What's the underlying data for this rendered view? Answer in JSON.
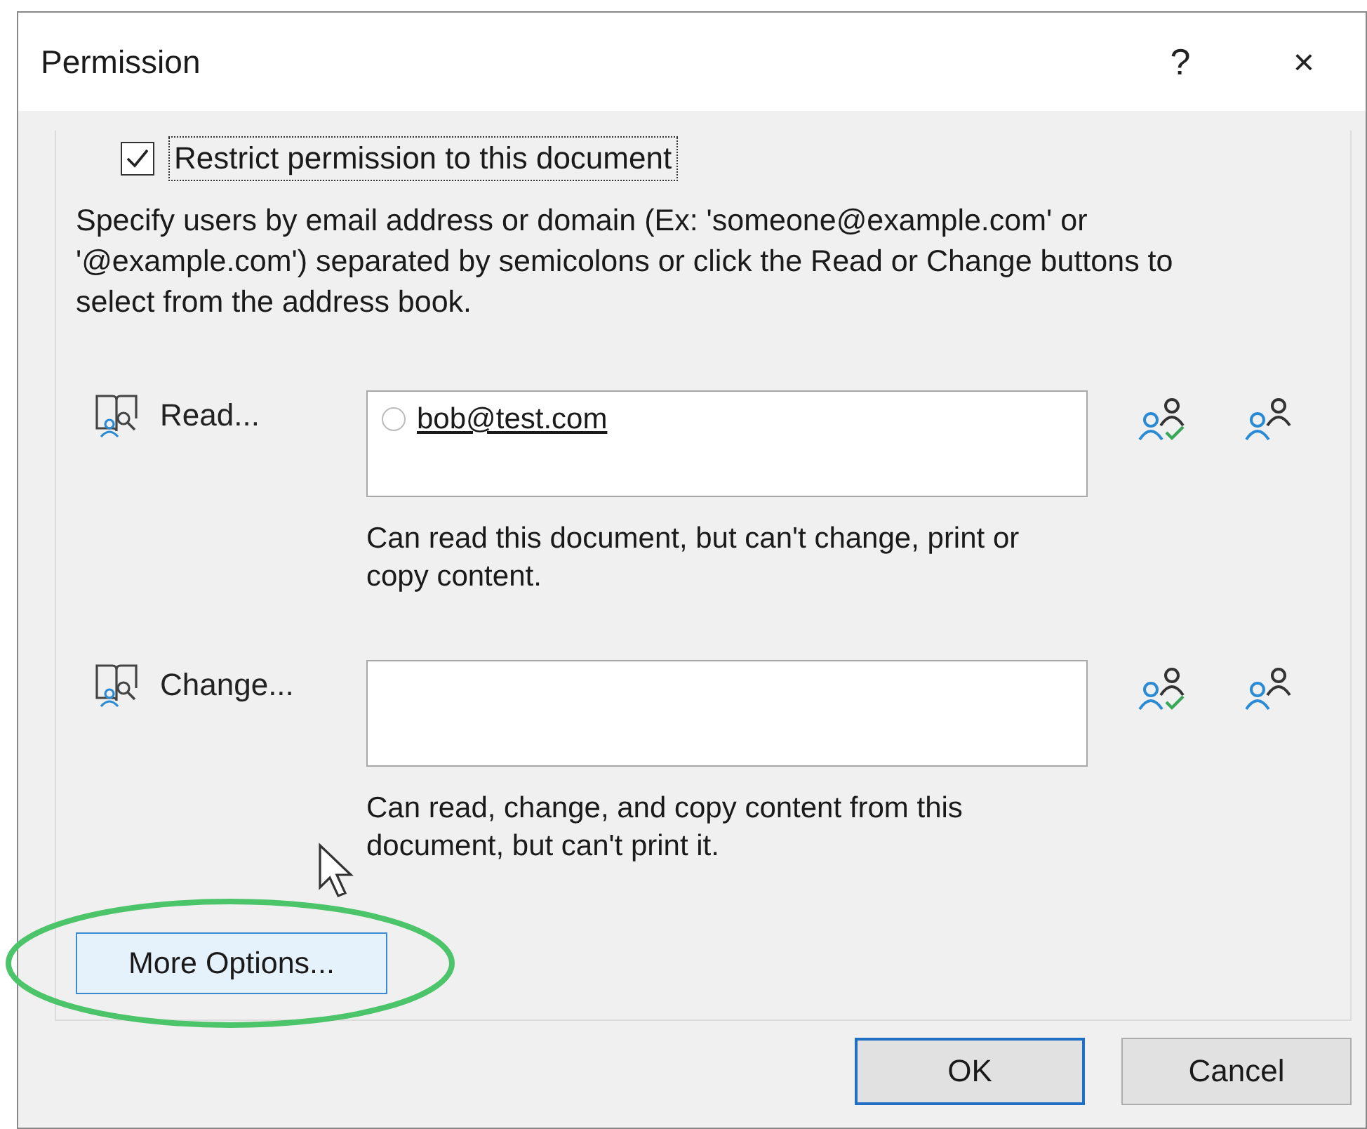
{
  "window": {
    "title": "Permission",
    "help": "?",
    "close": "×"
  },
  "restrict": {
    "label": "Restrict permission to this document",
    "checked": true
  },
  "instructions": "Specify users by email address or domain (Ex: 'someone@example.com' or '@example.com') separated by semicolons or click the Read or Change buttons to select from the address book.",
  "permissions": [
    {
      "label": "Read...",
      "entries": [
        "bob@test.com"
      ],
      "description": "Can read this document, but can't change, print or copy content."
    },
    {
      "label": "Change...",
      "description": "Can read, change, and copy content from this document, but can't print it."
    }
  ],
  "more_options": "More Options...",
  "buttons": [
    {
      "label": "OK",
      "default": true
    },
    {
      "label": "Cancel",
      "default": false
    }
  ]
}
